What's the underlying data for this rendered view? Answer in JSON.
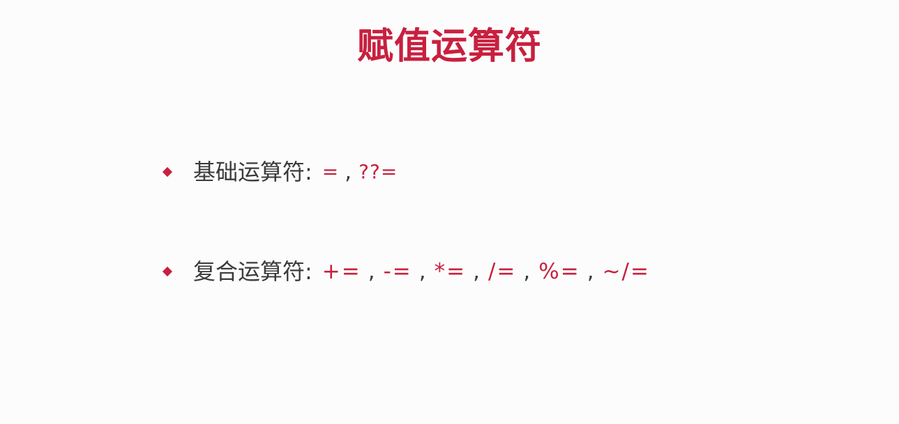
{
  "title": "赋值运算符",
  "colors": {
    "accent": "#c8203f",
    "text": "#3b3b3b",
    "background": "#fcfcfc"
  },
  "bullets": [
    {
      "label": "基础运算符",
      "colon": ":",
      "operators": [
        "=",
        "??="
      ],
      "separator": ","
    },
    {
      "label": "复合运算符",
      "colon": ":",
      "operators": [
        "+=",
        "-=",
        "*=",
        "/=",
        "%=",
        "~/="
      ],
      "separator": ","
    }
  ]
}
